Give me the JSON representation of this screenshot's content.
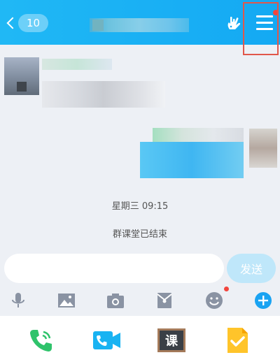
{
  "header": {
    "back_count": "10"
  },
  "messages": {
    "timestamp": "星期三 09:15",
    "system_notice": "群课堂已结束"
  },
  "composer": {
    "input_value": "",
    "input_placeholder": "",
    "send_label": "发送"
  },
  "toolbar": {
    "icons": [
      "microphone-icon",
      "image-icon",
      "camera-icon",
      "red-packet-icon",
      "emoji-icon",
      "plus-icon"
    ]
  },
  "panel": {
    "icons": [
      "phone-call-icon",
      "video-call-icon",
      "classroom-icon",
      "assignment-icon"
    ],
    "classroom_glyph": "课"
  },
  "colors": {
    "header": "#14a9f3",
    "accent": "#1aa3f2",
    "send_disabled": "#bfe7fa",
    "badge_red": "#f2453d",
    "annotation": "#e1574a"
  }
}
